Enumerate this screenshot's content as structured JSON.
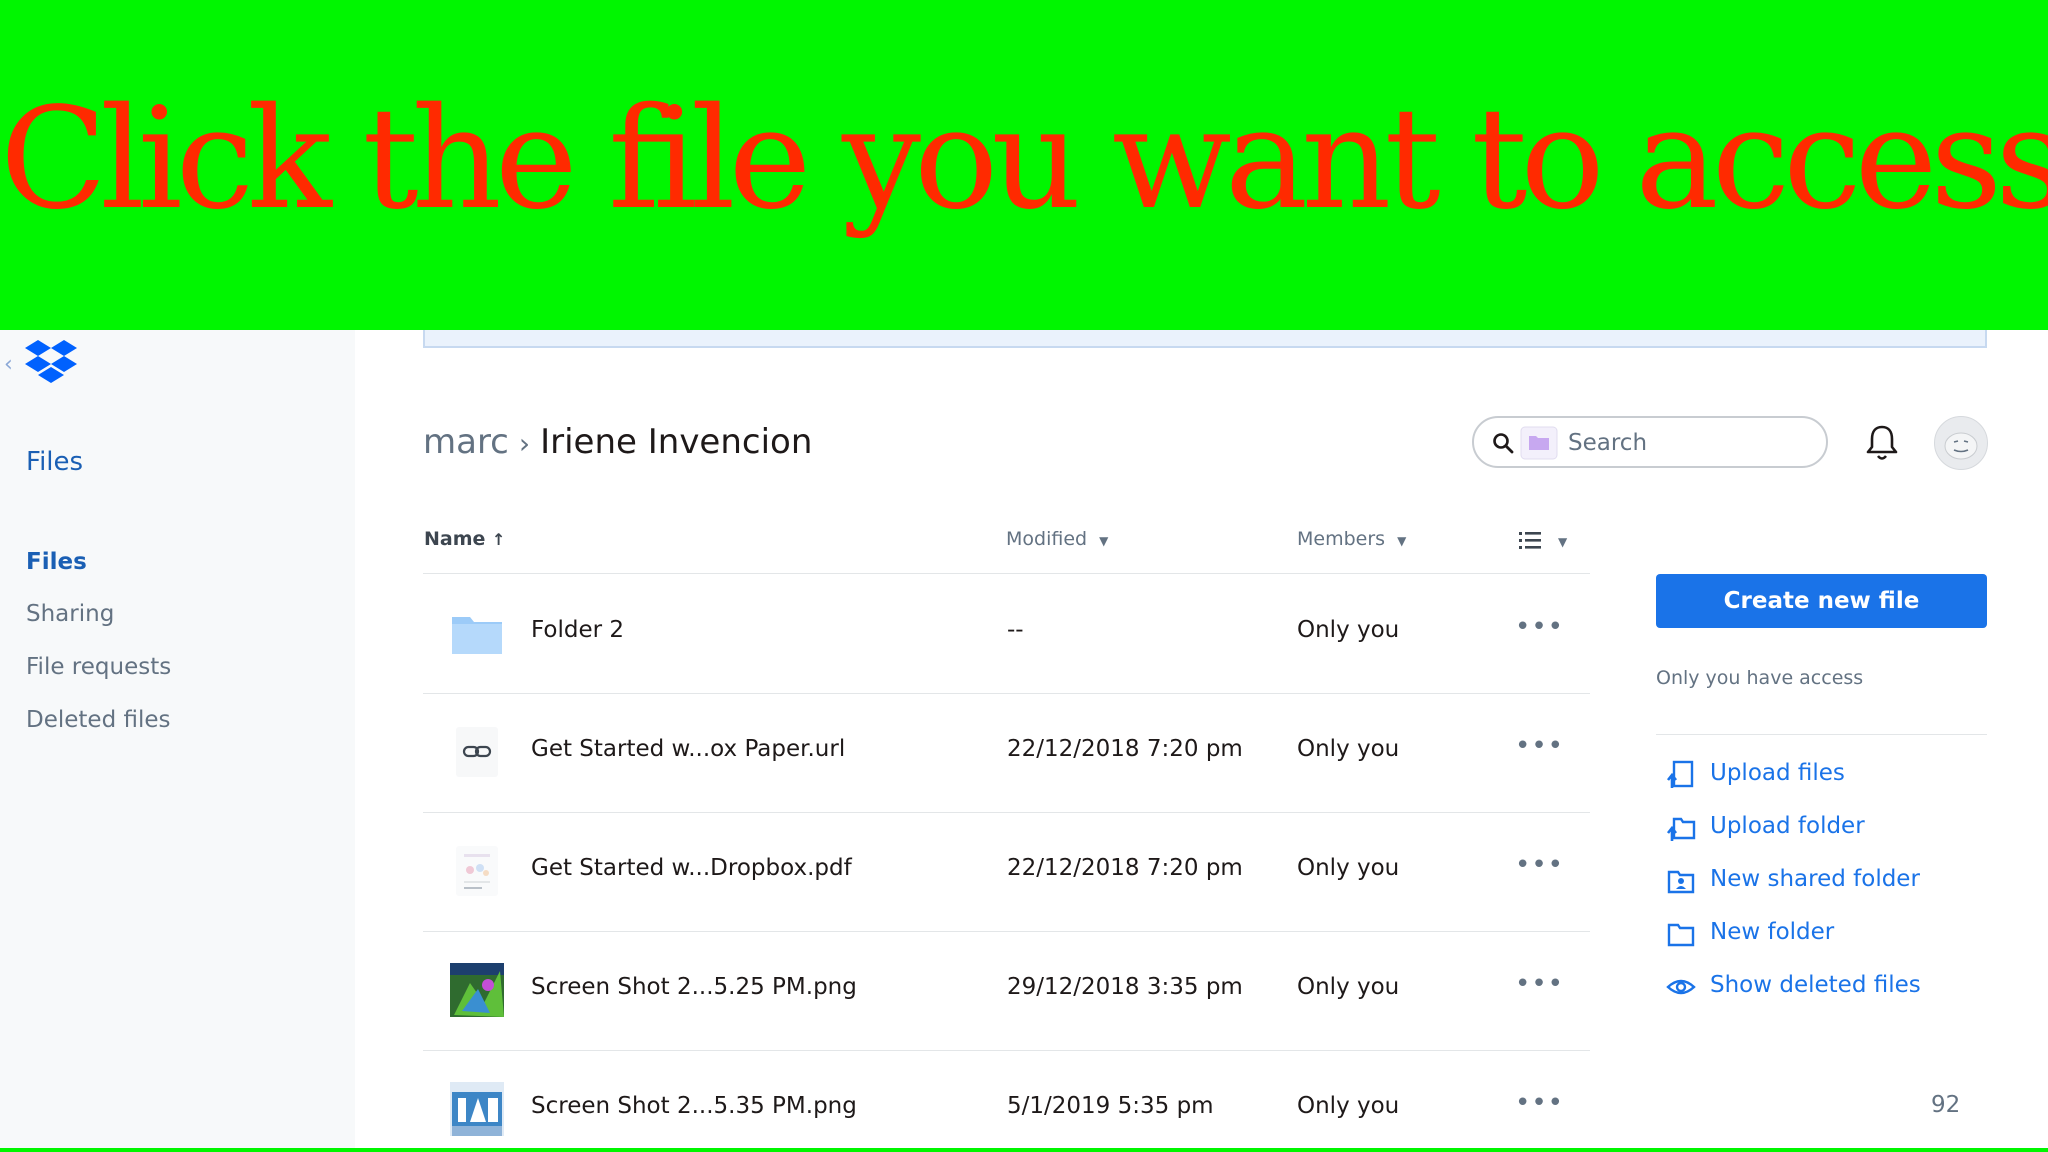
{
  "banner": {
    "text": "Click the file you want to access.",
    "bg_color": "#00f600",
    "text_color": "#ff2a00"
  },
  "sidebar": {
    "logo_icon": "dropbox-logo-icon",
    "collapse_icon": "chevron-left-icon",
    "title": "Files",
    "items": [
      {
        "label": "Files",
        "active": true
      },
      {
        "label": "Sharing",
        "active": false
      },
      {
        "label": "File requests",
        "active": false
      },
      {
        "label": "Deleted files",
        "active": false
      }
    ]
  },
  "breadcrumb": {
    "parent": "marc",
    "separator": "›",
    "current": "Iriene Invencion"
  },
  "search": {
    "placeholder": "Search",
    "icon": "search-icon"
  },
  "header_icons": {
    "notifications": "bell-icon",
    "avatar": "avatar"
  },
  "table": {
    "columns": {
      "name": "Name",
      "modified": "Modified",
      "members": "Members"
    },
    "rows": [
      {
        "icon": "folder-icon",
        "name": "Folder 2",
        "modified": "--",
        "members": "Only you",
        "more": "•••"
      },
      {
        "icon": "link-file-icon",
        "name": "Get Started w...ox Paper.url",
        "modified": "22/12/2018 7:20 pm",
        "members": "Only you",
        "more": "•••"
      },
      {
        "icon": "pdf-file-icon",
        "name": "Get Started w...Dropbox.pdf",
        "modified": "22/12/2018 7:20 pm",
        "members": "Only you",
        "more": "•••"
      },
      {
        "icon": "image-thumbnail-icon",
        "name": "Screen Shot 2...5.25 PM.png",
        "modified": "29/12/2018 3:35 pm",
        "members": "Only you",
        "more": "•••"
      },
      {
        "icon": "image-thumbnail-icon",
        "name": "Screen Shot 2...5.35 PM.png",
        "modified": "5/1/2019 5:35 pm",
        "members": "Only you",
        "more": "•••"
      }
    ]
  },
  "right_panel": {
    "create_button": "Create new file",
    "access_note": "Only you have access",
    "actions": [
      {
        "label": "Upload files",
        "icon": "upload-file-icon"
      },
      {
        "label": "Upload folder",
        "icon": "upload-folder-icon"
      },
      {
        "label": "New shared folder",
        "icon": "shared-folder-icon"
      },
      {
        "label": "New folder",
        "icon": "new-folder-icon"
      },
      {
        "label": "Show deleted files",
        "icon": "eye-icon"
      }
    ]
  },
  "page_number": "92",
  "colors": {
    "accent": "#1a73e8",
    "sidebar_active": "#1a5fb4",
    "muted_text": "#637282"
  }
}
